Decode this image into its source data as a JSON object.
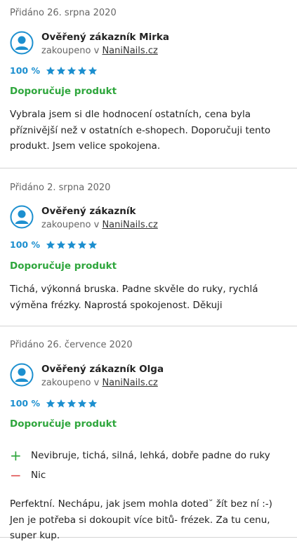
{
  "colors": {
    "accent": "#1c8fcf",
    "recommend": "#2ea63c",
    "star": "#1c8fcf",
    "cons": "#e05555"
  },
  "reviews": [
    {
      "date": "Přidáno 26. srpna 2020",
      "author": "Ověřený zákazník Mirka",
      "purchased_prefix": "zakoupeno v ",
      "shop": "NaniNails.cz",
      "percent": "100 %",
      "stars": 5,
      "recommend": "Doporučuje produkt",
      "text": "Vybrala jsem si dle hodnocení ostatních, cena byla příznivější než v ostatních e-shopech. Doporučuji tento produkt. Jsem velice spokojena."
    },
    {
      "date": "Přidáno 2. srpna 2020",
      "author": "Ověřený zákazník",
      "purchased_prefix": "zakoupeno v ",
      "shop": "NaniNails.cz",
      "percent": "100 %",
      "stars": 5,
      "recommend": "Doporučuje produkt",
      "text": "Tichá, výkonná bruska. Padne skvěle do ruky, rychlá výměna frézky. Naprostá spokojenost. Děkuji"
    },
    {
      "date": "Přidáno 26. července 2020",
      "author": "Ověřený zákazník Olga",
      "purchased_prefix": "zakoupeno v ",
      "shop": "NaniNails.cz",
      "percent": "100 %",
      "stars": 5,
      "recommend": "Doporučuje produkt",
      "pros": "Nevibruje, tichá, silná, lehká, dobře padne do ruky",
      "cons": "Nic",
      "text": "Perfektní. Nechápu, jak jsem mohla doted˘ žít bez ní :-) Jen je potřeba si dokoupit více bitů- frézek. Za tu cenu, super kup."
    }
  ]
}
